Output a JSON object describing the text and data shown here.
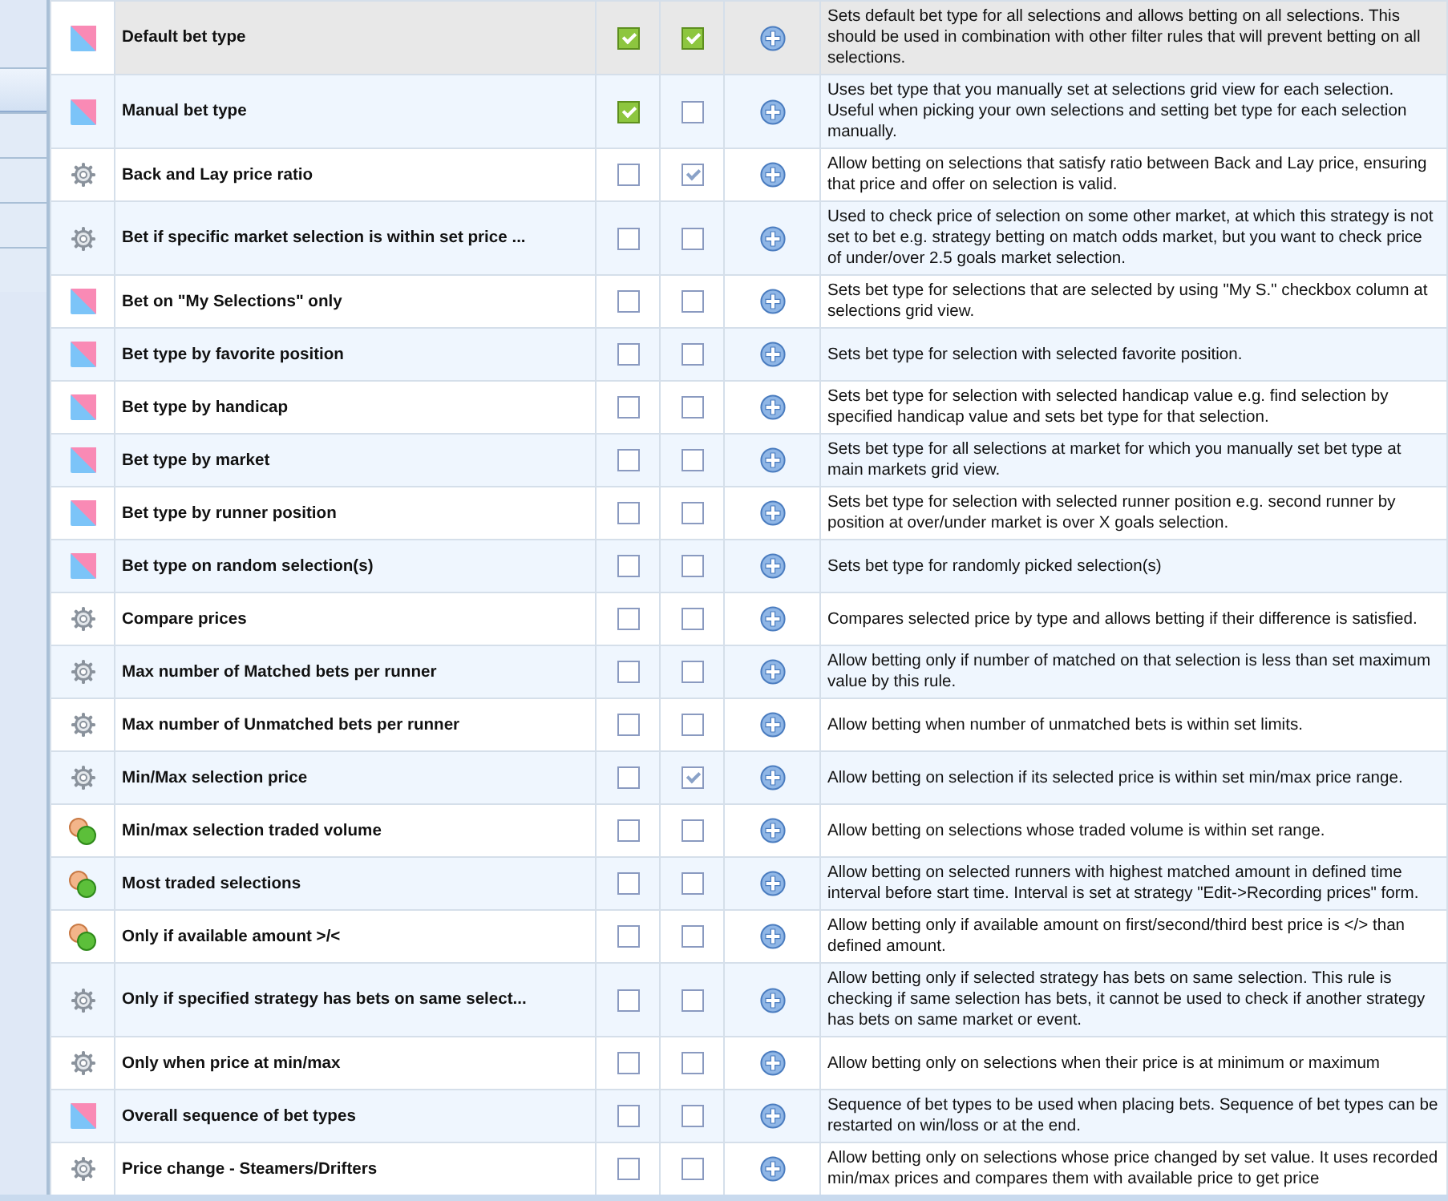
{
  "sidebar": {
    "tabs": [
      {
        "selected": true
      },
      {
        "selected": false
      },
      {
        "selected": false
      },
      {
        "selected": false
      },
      {
        "selected": false
      }
    ]
  },
  "rules": [
    {
      "kind": "bettype",
      "name": "Default bet type",
      "selected": true,
      "checks": [
        {
          "checked": true,
          "kind": "green"
        },
        {
          "checked": true,
          "kind": "green"
        }
      ],
      "description": "Sets default bet type for all selections and allows betting on all selections. This should be used in combination with other filter rules that will prevent betting on all selections."
    },
    {
      "kind": "bettype",
      "name": "Manual bet type",
      "selected": false,
      "checks": [
        {
          "checked": true,
          "kind": "green"
        },
        {
          "checked": false,
          "kind": "plain"
        }
      ],
      "description": "Uses bet type that you manually set at selections grid view for each selection. Useful when picking your own selections and setting bet type for each selection manually."
    },
    {
      "kind": "gear",
      "name": "Back and Lay price ratio",
      "selected": false,
      "checks": [
        {
          "checked": false,
          "kind": "plain"
        },
        {
          "checked": true,
          "kind": "plain"
        }
      ],
      "description": "Allow betting on selections that satisfy ratio between Back and Lay price, ensuring that price and offer on selection is valid."
    },
    {
      "kind": "gear",
      "name": "Bet if specific market selection is within set price ...",
      "selected": false,
      "checks": [
        {
          "checked": false,
          "kind": "plain"
        },
        {
          "checked": false,
          "kind": "plain"
        }
      ],
      "description": "Used to check price of selection on some other market, at which this strategy is not set to bet e.g. strategy betting on match odds market, but you want to check price of under/over 2.5 goals market selection."
    },
    {
      "kind": "bettype",
      "name": "Bet on \"My Selections\" only",
      "selected": false,
      "checks": [
        {
          "checked": false,
          "kind": "plain"
        },
        {
          "checked": false,
          "kind": "plain"
        }
      ],
      "description": "Sets bet type for selections that are selected by using \"My S.\" checkbox column at selections grid view."
    },
    {
      "kind": "bettype",
      "name": "Bet type by favorite position",
      "selected": false,
      "checks": [
        {
          "checked": false,
          "kind": "plain"
        },
        {
          "checked": false,
          "kind": "plain"
        }
      ],
      "description": "Sets bet type for selection with selected favorite position."
    },
    {
      "kind": "bettype",
      "name": "Bet type by handicap",
      "selected": false,
      "checks": [
        {
          "checked": false,
          "kind": "plain"
        },
        {
          "checked": false,
          "kind": "plain"
        }
      ],
      "description": "Sets bet type for selection with selected handicap value e.g. find selection by specified handicap value and sets bet type for that selection."
    },
    {
      "kind": "bettype",
      "name": "Bet type by market",
      "selected": false,
      "checks": [
        {
          "checked": false,
          "kind": "plain"
        },
        {
          "checked": false,
          "kind": "plain"
        }
      ],
      "description": "Sets bet type for all selections at market for which you manually set bet type at main markets grid view."
    },
    {
      "kind": "bettype",
      "name": "Bet type by runner position",
      "selected": false,
      "checks": [
        {
          "checked": false,
          "kind": "plain"
        },
        {
          "checked": false,
          "kind": "plain"
        }
      ],
      "description": "Sets bet type for selection with selected runner position e.g. second runner by position at over/under market is over X goals selection."
    },
    {
      "kind": "bettype",
      "name": "Bet type on random selection(s)",
      "selected": false,
      "checks": [
        {
          "checked": false,
          "kind": "plain"
        },
        {
          "checked": false,
          "kind": "plain"
        }
      ],
      "description": "Sets bet type for randomly picked selection(s)"
    },
    {
      "kind": "gear",
      "name": "Compare prices",
      "selected": false,
      "checks": [
        {
          "checked": false,
          "kind": "plain"
        },
        {
          "checked": false,
          "kind": "plain"
        }
      ],
      "description": "Compares selected price by type and allows betting if their difference is satisfied."
    },
    {
      "kind": "gear",
      "name": "Max number of Matched bets per runner",
      "selected": false,
      "checks": [
        {
          "checked": false,
          "kind": "plain"
        },
        {
          "checked": false,
          "kind": "plain"
        }
      ],
      "description": "Allow betting only if number of matched on that selection is less than set maximum value by this rule."
    },
    {
      "kind": "gear",
      "name": "Max number of Unmatched bets per runner",
      "selected": false,
      "checks": [
        {
          "checked": false,
          "kind": "plain"
        },
        {
          "checked": false,
          "kind": "plain"
        }
      ],
      "description": "Allow betting when number of unmatched bets is within set limits."
    },
    {
      "kind": "gear",
      "name": "Min/Max selection price",
      "selected": false,
      "checks": [
        {
          "checked": false,
          "kind": "plain"
        },
        {
          "checked": true,
          "kind": "plain"
        }
      ],
      "description": "Allow betting on selection if its selected price is within set min/max price range."
    },
    {
      "kind": "money",
      "name": "Min/max selection traded volume",
      "selected": false,
      "checks": [
        {
          "checked": false,
          "kind": "plain"
        },
        {
          "checked": false,
          "kind": "plain"
        }
      ],
      "description": "Allow betting on selections whose traded volume is within set range."
    },
    {
      "kind": "money",
      "name": "Most traded selections",
      "selected": false,
      "checks": [
        {
          "checked": false,
          "kind": "plain"
        },
        {
          "checked": false,
          "kind": "plain"
        }
      ],
      "description": "Allow betting on selected runners with highest matched amount in defined time interval before start time. Interval is set at strategy \"Edit->Recording prices\" form."
    },
    {
      "kind": "money",
      "name": "Only if available amount >/<",
      "selected": false,
      "checks": [
        {
          "checked": false,
          "kind": "plain"
        },
        {
          "checked": false,
          "kind": "plain"
        }
      ],
      "description": "Allow betting only if available amount on first/second/third best price is </> than defined amount."
    },
    {
      "kind": "gear",
      "name": "Only if specified strategy has bets on same select...",
      "selected": false,
      "checks": [
        {
          "checked": false,
          "kind": "plain"
        },
        {
          "checked": false,
          "kind": "plain"
        }
      ],
      "description": "Allow betting only if selected strategy has bets on same selection. This rule is checking if same selection has bets, it cannot be used to check if another strategy has bets on same market or event."
    },
    {
      "kind": "gear",
      "name": "Only when price at min/max",
      "selected": false,
      "checks": [
        {
          "checked": false,
          "kind": "plain"
        },
        {
          "checked": false,
          "kind": "plain"
        }
      ],
      "description": "Allow betting only on selections when their price is at minimum or maximum"
    },
    {
      "kind": "bettype",
      "name": "Overall sequence of bet types",
      "selected": false,
      "checks": [
        {
          "checked": false,
          "kind": "plain"
        },
        {
          "checked": false,
          "kind": "plain"
        }
      ],
      "description": "Sequence of bet types to be used when placing bets. Sequence of bet types can be restarted on win/loss or at the end."
    },
    {
      "kind": "gear",
      "name": "Price change - Steamers/Drifters",
      "selected": false,
      "checks": [
        {
          "checked": false,
          "kind": "plain"
        },
        {
          "checked": false,
          "kind": "plain"
        }
      ],
      "description": "Allow betting only on selections whose price changed by set value. It uses recorded min/max prices and compares them with available price to get price"
    }
  ]
}
